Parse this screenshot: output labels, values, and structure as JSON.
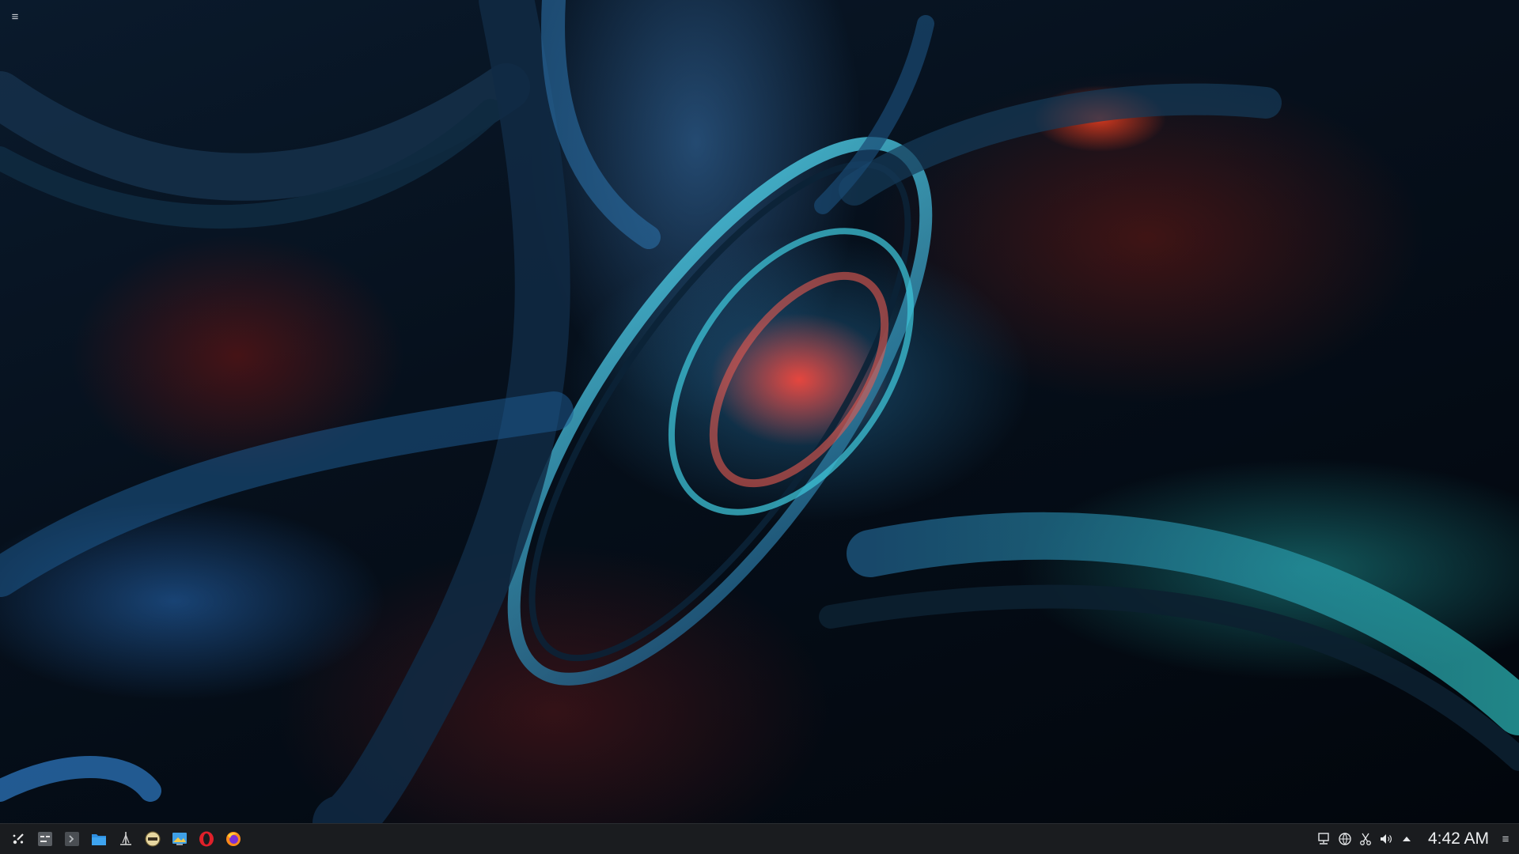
{
  "desktop": {
    "menu_glyph": "≡"
  },
  "taskbar": {
    "launchers": [
      {
        "icon": "app-launcher-icon",
        "color": "#e8e8e8"
      },
      {
        "icon": "system-settings-icon",
        "color": "#5a5e63"
      },
      {
        "icon": "terminal-icon",
        "color": "#4a4e53"
      },
      {
        "icon": "file-manager-icon",
        "color": "#2f8fe0"
      },
      {
        "icon": "ksnip-icon",
        "color": "#d0d0d0"
      },
      {
        "icon": "qbittorrent-icon",
        "color": "#e6d6a0"
      },
      {
        "icon": "image-viewer-icon",
        "color": "#3fa0e6"
      },
      {
        "icon": "opera-icon",
        "color": "#e0202a"
      },
      {
        "icon": "firefox-icon",
        "color": "#ff8a1a"
      }
    ],
    "tray": {
      "icons": [
        "network-icon",
        "vpn-icon",
        "clipboard-icon",
        "volume-icon",
        "show-hidden-icon"
      ],
      "clock": "4:42 AM",
      "menu_glyph": "≡"
    }
  }
}
